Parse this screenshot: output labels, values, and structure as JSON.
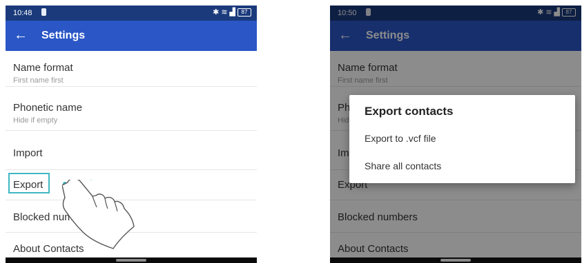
{
  "left_screen": {
    "status_bar": {
      "time": "10:48",
      "battery": "87",
      "icons": [
        "bluetooth-icon",
        "wifi-icon",
        "signal-icon",
        "battery-icon"
      ]
    },
    "app_bar": {
      "back_icon": "arrow-back-icon",
      "title": "Settings"
    },
    "items": [
      {
        "title": "Name format",
        "subtitle": "First name first"
      },
      {
        "title": "Phonetic name",
        "subtitle": "Hide if empty"
      },
      {
        "title": "Import"
      },
      {
        "title": "Export"
      },
      {
        "title": "Blocked numbers"
      },
      {
        "title": "About Contacts"
      }
    ],
    "highlight_color": "#3fb7c4",
    "gesture_icon": "tap-hand-icon"
  },
  "right_screen": {
    "status_bar": {
      "time": "10:50",
      "battery": "87",
      "icons": [
        "bluetooth-icon",
        "wifi-icon",
        "signal-icon",
        "battery-icon"
      ]
    },
    "app_bar": {
      "back_icon": "arrow-back-icon",
      "title": "Settings"
    },
    "items": [
      {
        "title": "Name format",
        "subtitle": "First name first"
      },
      {
        "title": "Phonetic name",
        "subtitle": "Hide if empty"
      },
      {
        "title": "Import"
      },
      {
        "title": "Export"
      },
      {
        "title": "Blocked numbers"
      },
      {
        "title": "About Contacts"
      }
    ],
    "dialog": {
      "title": "Export contacts",
      "options": [
        "Export to .vcf file",
        "Share all contacts"
      ]
    }
  },
  "colors": {
    "status_bar": "#1b3a7c",
    "app_bar": "#2a56c6",
    "scrim": "rgba(0,0,0,0.45)"
  }
}
